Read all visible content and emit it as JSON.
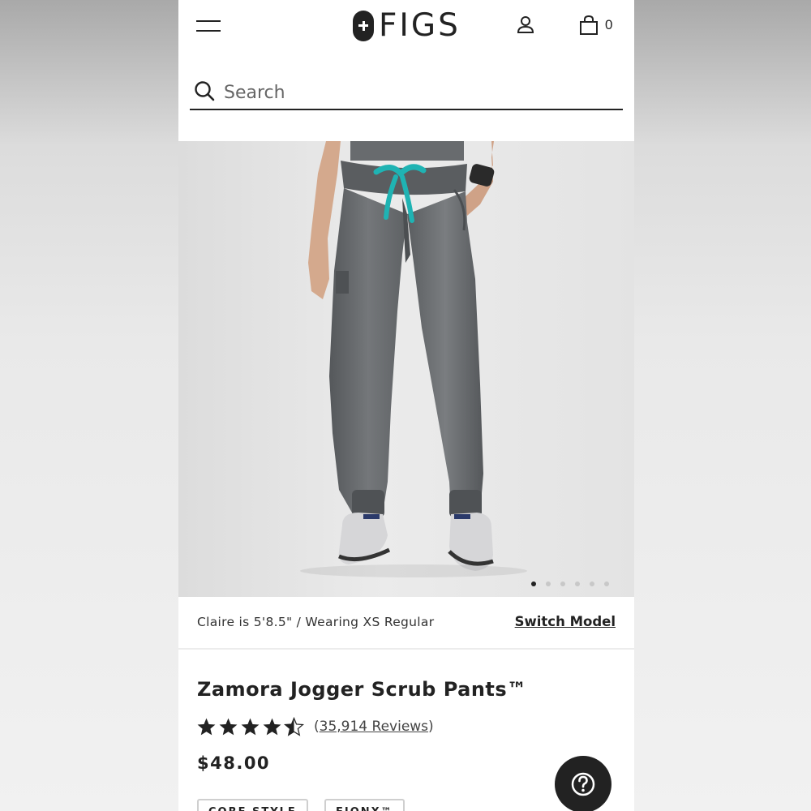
{
  "header": {
    "logo_text": "FIGS",
    "cart_count": "0",
    "icons": {
      "menu": "hamburger-menu-icon",
      "account": "user-icon",
      "cart": "shopping-bag-icon"
    }
  },
  "search": {
    "placeholder": "Search",
    "icon": "search-icon"
  },
  "gallery": {
    "image_count": 6,
    "active_index": 0
  },
  "model": {
    "info": "Claire is 5'8.5\" / Wearing XS Regular",
    "switch_label": "Switch Model"
  },
  "product": {
    "title": "Zamora Jogger Scrub Pants™",
    "rating": 4.5,
    "reviews_open": "(",
    "reviews_count": "35,914 Reviews",
    "reviews_close": ")",
    "price": "$48.00",
    "tags": [
      "CORE STYLE",
      "FIONX™"
    ]
  },
  "help": {
    "icon": "question-mark-icon"
  },
  "colors": {
    "page_bg": "#e9e9e9",
    "text": "#222222",
    "drawstring": "#1fb3b3",
    "fabric": "#6a6d70"
  }
}
